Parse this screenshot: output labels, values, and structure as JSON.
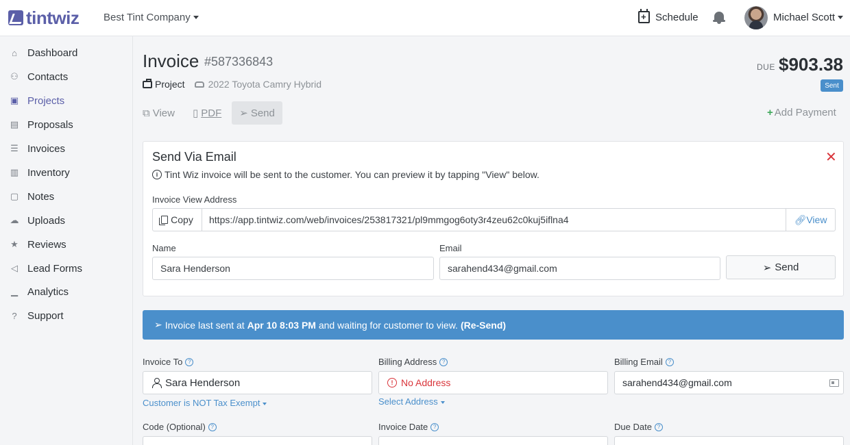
{
  "app": {
    "logo": "tintwiz",
    "company": "Best Tint Company",
    "schedule_label": "Schedule",
    "user_name": "Michael Scott"
  },
  "sidebar": {
    "items": [
      {
        "label": "Dashboard",
        "icon": "home-icon"
      },
      {
        "label": "Contacts",
        "icon": "contacts-icon"
      },
      {
        "label": "Projects",
        "icon": "briefcase-icon",
        "active": true
      },
      {
        "label": "Proposals",
        "icon": "proposal-icon"
      },
      {
        "label": "Invoices",
        "icon": "invoice-icon"
      },
      {
        "label": "Inventory",
        "icon": "clipboard-icon"
      },
      {
        "label": "Notes",
        "icon": "note-icon"
      },
      {
        "label": "Uploads",
        "icon": "cloud-upload-icon"
      },
      {
        "label": "Reviews",
        "icon": "star-icon"
      },
      {
        "label": "Lead Forms",
        "icon": "megaphone-icon"
      },
      {
        "label": "Analytics",
        "icon": "chart-icon"
      },
      {
        "label": "Support",
        "icon": "question-icon"
      }
    ]
  },
  "invoice": {
    "title": "Invoice",
    "number": "#587336843",
    "project_label": "Project",
    "vehicle": "2022 Toyota Camry Hybrid",
    "due_label": "DUE",
    "due_amount": "$903.38",
    "status": "Sent",
    "actions": {
      "view": "View",
      "pdf": "PDF",
      "send": "Send",
      "add_payment": "Add Payment"
    }
  },
  "email_card": {
    "title": "Send Via Email",
    "info": "Tint Wiz invoice will be sent to the customer. You can preview it by tapping \"View\" below.",
    "url_label": "Invoice View Address",
    "copy_label": "Copy",
    "url": "https://app.tintwiz.com/web/invoices/253817321/pl9mmgog6oty3r4zeu62c0kuj5iflna4",
    "view_label": "View",
    "name_label": "Name",
    "name_value": "Sara Henderson",
    "email_label": "Email",
    "email_value": "sarahend434@gmail.com",
    "send_label": "Send"
  },
  "banner": {
    "prefix": "Invoice last sent at",
    "time": "Apr 10 8:03 PM",
    "middle": "and waiting for customer to view.",
    "resend": "(Re-Send)"
  },
  "form": {
    "invoice_to_label": "Invoice To",
    "invoice_to_value": "Sara Henderson",
    "tax_link": "Customer is NOT Tax Exempt",
    "billing_address_label": "Billing Address",
    "billing_address_value": "No Address",
    "select_address": "Select Address",
    "billing_email_label": "Billing Email",
    "billing_email_value": "sarahend434@gmail.com",
    "code_label": "Code (Optional)",
    "invoice_date_label": "Invoice Date",
    "due_date_label": "Due Date"
  },
  "colors": {
    "brand": "#5b5fa8",
    "accent": "#4a8fcb",
    "danger": "#d9343a",
    "success": "#3ea85a"
  }
}
